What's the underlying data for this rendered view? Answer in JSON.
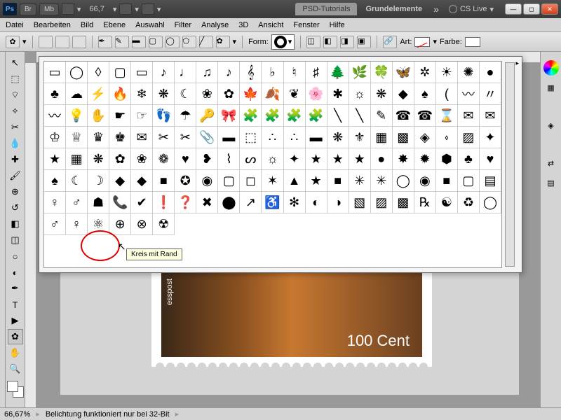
{
  "titlebar": {
    "br": "Br",
    "mb": "Mb",
    "zoom": "66,7",
    "tab_psd": "PSD-Tutorials",
    "doc_name": "Grundelemente",
    "cslive": "CS Live"
  },
  "menu": {
    "datei": "Datei",
    "bearbeiten": "Bearbeiten",
    "bild": "Bild",
    "ebene": "Ebene",
    "auswahl": "Auswahl",
    "filter": "Filter",
    "analyse": "Analyse",
    "dreid": "3D",
    "ansicht": "Ansicht",
    "fenster": "Fenster",
    "hilfe": "Hilfe"
  },
  "options": {
    "form_label": "Form:",
    "art_label": "Art:",
    "farbe_label": "Farbe:"
  },
  "shapes": {
    "tooltip": "Kreis mit Rand",
    "glyphs": [
      "▭",
      "◯",
      "◊",
      "▢",
      "▭",
      "♪",
      "♩",
      "♫",
      "♪",
      "𝄞",
      "♭",
      "♮",
      "♯",
      "🌲",
      "🌿",
      "🍀",
      "🦋",
      "✲",
      "☀",
      "✺",
      "●",
      "♣",
      "☁",
      "⚡",
      "🔥",
      "❄",
      "❋",
      "☾",
      "❀",
      "✿",
      "🍁",
      "🍂",
      "❦",
      "🌸",
      "✱",
      "☼",
      "❋",
      "◆",
      "♠",
      "(",
      "〰",
      "〃",
      "〰",
      "💡",
      "✋",
      "☛",
      "☞",
      "👣",
      "☂",
      "🔑",
      "🎀",
      "🧩",
      "🧩",
      "🧩",
      "🧩",
      "╲",
      "╲",
      "✎",
      "☎",
      "☎",
      "⌛",
      "✉",
      "✉",
      "♔",
      "♕",
      "♛",
      "♚",
      "✉",
      "✂",
      "✂",
      "📎",
      "▬",
      "⬚",
      "∴",
      "∴",
      "▬",
      "❋",
      "⚜",
      "▦",
      "▩",
      "◈",
      "⬫",
      "▨",
      "✦",
      "★",
      "▦",
      "❋",
      "✿",
      "❀",
      "❁",
      "♥",
      "❥",
      "⌇",
      "ᔕ",
      "☼",
      "✦",
      "★",
      "★",
      "★",
      "●",
      "✸",
      "✹",
      "⬢",
      "♣",
      "♥",
      "♠",
      "☾",
      "☽",
      "◆",
      "◆",
      "■",
      "✪",
      "◉",
      "▢",
      "◻",
      "✶",
      "▲",
      "★",
      "■",
      "✳",
      "✳",
      "◯",
      "◉",
      "■",
      "▢",
      "▤",
      "♀",
      "♂",
      "☗",
      "📞",
      "✔",
      "❗",
      "❓",
      "✖",
      "⬤",
      "↗",
      "♿",
      "✻",
      "◐",
      "◑",
      "▧",
      "▨",
      "▩",
      "℞",
      "☯",
      "♻",
      "◯",
      "♂",
      "♀",
      "⚛",
      "⊕",
      "⊗",
      "☢"
    ]
  },
  "stamp": {
    "value": "100 Cent",
    "side": "esspost"
  },
  "status": {
    "zoom": "66,67%",
    "msg": "Belichtung funktioniert nur bei 32-Bit"
  }
}
